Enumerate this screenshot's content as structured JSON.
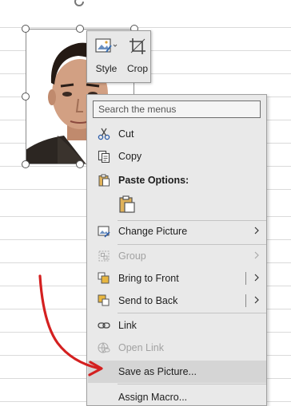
{
  "mini_toolbar": {
    "style_label": "Style",
    "crop_label": "Crop"
  },
  "context_menu": {
    "search_placeholder": "Search the menus",
    "cut": "Cut",
    "copy": "Copy",
    "paste_options": "Paste Options:",
    "change_picture": "Change Picture",
    "group": "Group",
    "bring_to_front": "Bring to Front",
    "send_to_back": "Send to Back",
    "link": "Link",
    "open_link": "Open Link",
    "save_as_picture": "Save as Picture...",
    "assign_macro": "Assign Macro..."
  },
  "colors": {
    "annotation": "#d42020",
    "menu_background": "#e9e9e9",
    "menu_hover": "#d5d5d5",
    "disabled_text": "#a2a2a2"
  },
  "icons": [
    "rotate-icon",
    "picture-style-icon",
    "crop-icon",
    "scissors-icon",
    "copy-icon",
    "paste-icon",
    "paste-option-icon",
    "change-picture-icon",
    "group-icon",
    "bring-to-front-icon",
    "send-to-back-icon",
    "link-icon",
    "open-link-icon",
    "chevron-right-icon"
  ]
}
